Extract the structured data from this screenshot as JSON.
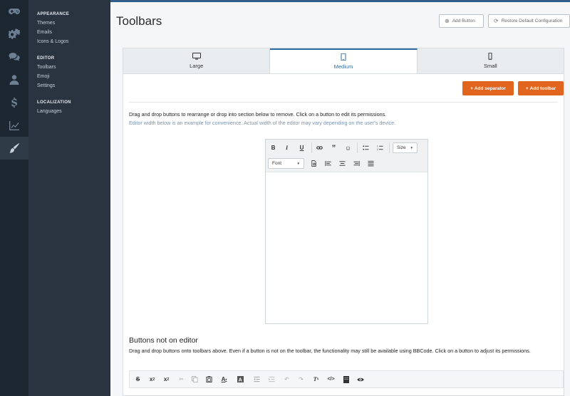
{
  "rail": [
    {
      "icon": "gamepad-icon"
    },
    {
      "icon": "gears-icon"
    },
    {
      "icon": "comments-icon"
    },
    {
      "icon": "user-icon"
    },
    {
      "icon": "dollar-icon"
    },
    {
      "icon": "chart-line-icon"
    },
    {
      "icon": "paintbrush-icon",
      "active": true
    }
  ],
  "subnav": {
    "appearance": {
      "heading": "APPEARANCE",
      "items": [
        "Themes",
        "Emails",
        "Icons & Logos"
      ]
    },
    "editor": {
      "heading": "EDITOR",
      "items": [
        "Toolbars",
        "Emoji",
        "Settings"
      ]
    },
    "localization": {
      "heading": "LOCALIZATION",
      "items": [
        "Languages"
      ]
    }
  },
  "header": {
    "title": "Toolbars",
    "add_button": "Add Button",
    "restore_button": "Restore Default Configuration"
  },
  "tabs": [
    {
      "label": "Large",
      "icon": "desktop-icon"
    },
    {
      "label": "Medium",
      "icon": "tablet-icon",
      "active": true
    },
    {
      "label": "Small",
      "icon": "mobile-icon"
    }
  ],
  "actions": {
    "add_separator": "Add separator",
    "add_toolbar": "Add toolbar"
  },
  "instructions": {
    "main": "Drag and drop buttons to rearrange or drop into section below to remove. Click on a button to edit its permissions.",
    "note": "Editor width below is an example for convenience. Actual width of the editor may vary depending on the user's device."
  },
  "editor": {
    "size_label": "Size",
    "font_label": "Font"
  },
  "buttons_not_on_editor": {
    "title": "Buttons not on editor",
    "description": "Drag and drop buttons onto toolbars above. Even if a button is not on the toolbar, the functionality may still be available using BBCode. Click on a button to adjust its permissions."
  },
  "colors": {
    "accent": "#e1651f",
    "tab_active": "#2e6da4",
    "sidebar_dark": "#1d2731",
    "sidebar": "#2a3440"
  }
}
